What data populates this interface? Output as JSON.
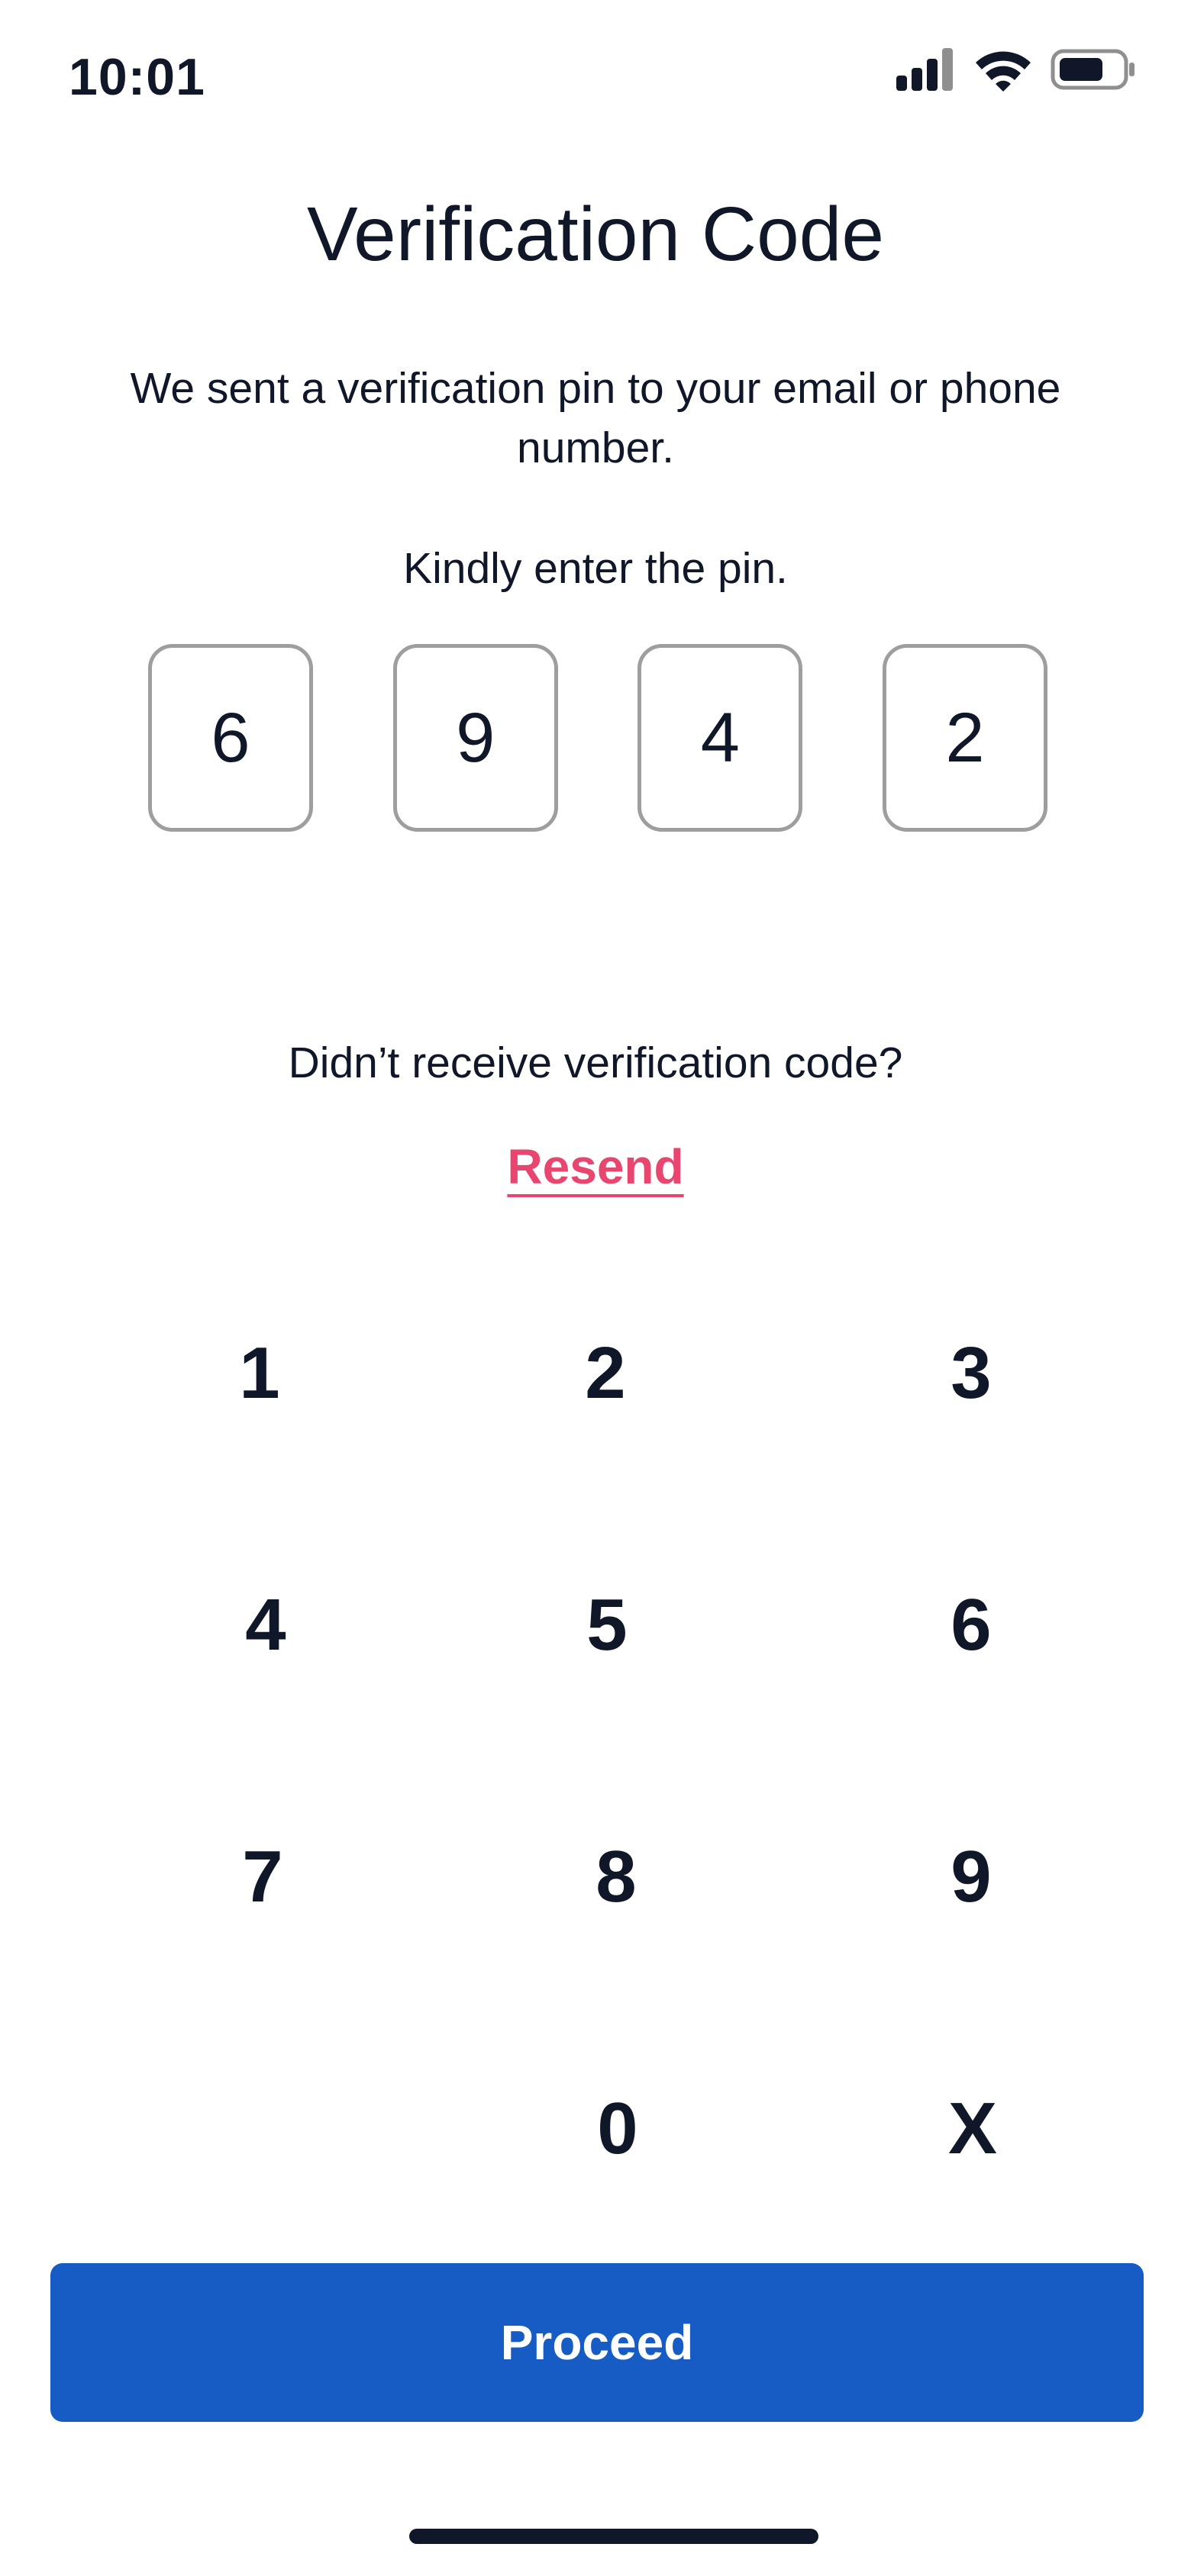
{
  "status_bar": {
    "time": "10:01",
    "icons": [
      "signal-icon",
      "wifi-icon",
      "battery-icon"
    ]
  },
  "header": {
    "title": "Verification Code"
  },
  "instructions": {
    "subtitle": "We sent a verification pin to your email or phone number.",
    "prompt": "Kindly enter the pin."
  },
  "pin": {
    "digits": [
      "6",
      "9",
      "4",
      "2"
    ]
  },
  "resend": {
    "question": "Didn’t receive verification code?",
    "link_label": "Resend"
  },
  "keypad": {
    "keys": [
      "1",
      "2",
      "3",
      "4",
      "5",
      "6",
      "7",
      "8",
      "9",
      "",
      "0",
      "X"
    ]
  },
  "actions": {
    "proceed_label": "Proceed"
  },
  "colors": {
    "primary": "#175cc4",
    "link": "#e8456f",
    "text": "#0f1729",
    "pin_border": "#9e9e9e"
  }
}
